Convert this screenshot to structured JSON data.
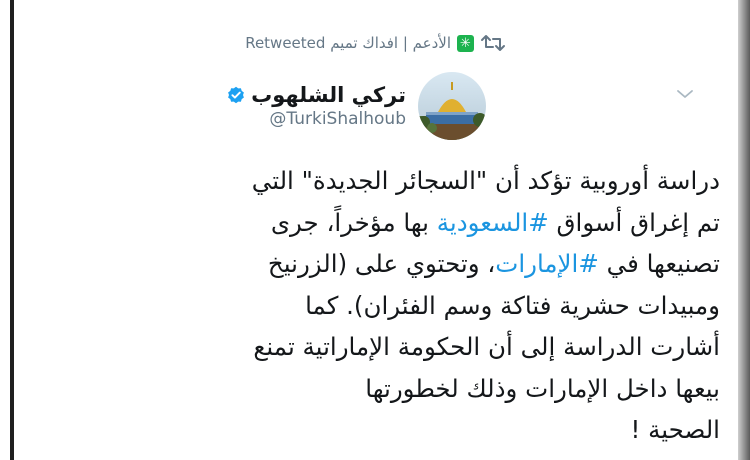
{
  "retweet": {
    "retweeted_label": "Retweeted",
    "retweeter_name": "الأدعم | افداك تميم",
    "badge_icon": "green-asterisk-badge",
    "icon": "retweet-icon"
  },
  "author": {
    "display_name": "تركي الشلهوب",
    "handle": "@TurkiShalhoub",
    "verified": true,
    "verified_color": "#1da1f2"
  },
  "tweet": {
    "line1": "دراسة أوروبية تؤكد أن \"السجائر الجديدة\" التي",
    "line2_before": "تم إغراق أسواق ",
    "hashtag1": "#السعودية",
    "line2_after": " بها مؤخراً، جرى",
    "line3_before": "تصنيعها في ",
    "hashtag2": "#الإمارات",
    "line3_after": "، وتحتوي على  (الزرنيخ",
    "line4": "ومبيدات حشرية فتاكة وسم الفئران). كما",
    "line5": "أشارت الدراسة إلى أن الحكومة الإماراتية تمنع",
    "line6": "بيعها داخل الإمارات وذلك لخطورتها",
    "line7": "الصحية !"
  },
  "colors": {
    "link": "#1b95e0",
    "secondary_text": "#657786",
    "primary_text": "#14171a",
    "badge_green": "#1db34f"
  }
}
